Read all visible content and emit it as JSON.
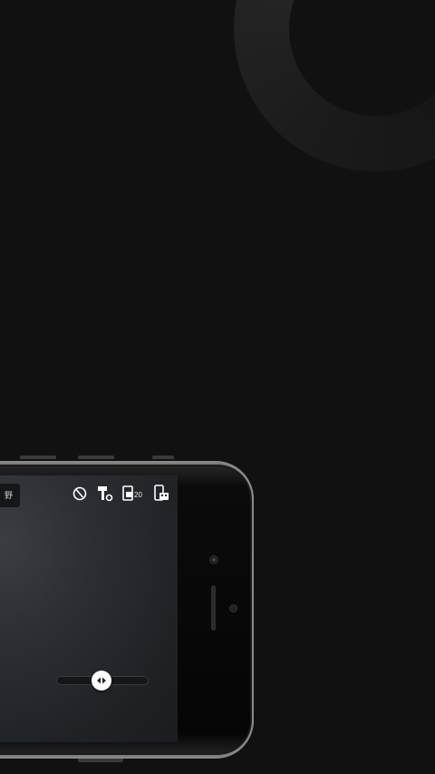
{
  "screen": {
    "status_text": "野",
    "toolbar": {
      "items": [
        {
          "icon": "slash-circle-icon"
        },
        {
          "icon": "shelf-settings-icon"
        },
        {
          "icon": "frame-count-icon",
          "label": "20"
        },
        {
          "icon": "battery-device-icon"
        }
      ]
    },
    "slider": {
      "value": 0.5,
      "thumb_icon": "left-right-arrows-icon"
    }
  },
  "colors": {
    "background": "#111111",
    "accent": "#ffffff"
  }
}
